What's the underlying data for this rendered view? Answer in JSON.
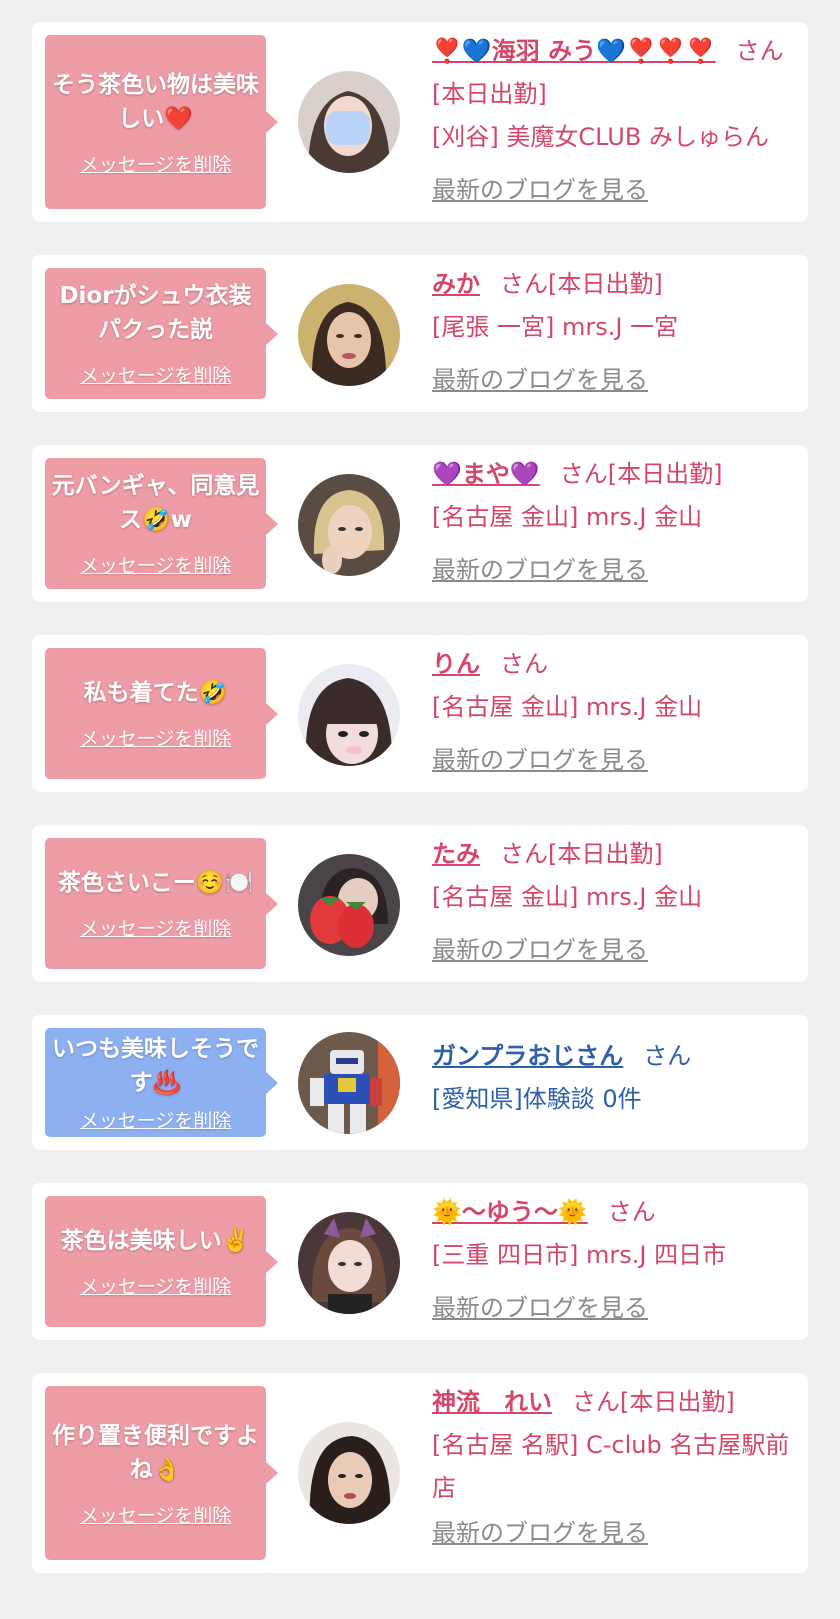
{
  "delete_label": "メッセージを削除",
  "blog_label": "最新のブログを見る",
  "colors": {
    "background": "#f0f0f0",
    "bubble_pink": "#ee9ca6",
    "bubble_blue": "#8db0f0",
    "text_pink": "#d4466a",
    "text_blue": "#2f5fa8"
  },
  "items": [
    {
      "message": "そう茶色い物は美味しい❤️",
      "name": "❣️💙海羽 みう💙❣️❣️❣️",
      "san": "さん",
      "status": "",
      "line2": "[本日出勤]",
      "line3": "[刈谷] 美魔女CLUB みしゅらん",
      "blog": "最新のブログを見る"
    },
    {
      "message": "Diorがシュウ衣装パクった説",
      "name": "みか",
      "san": "さん",
      "status": "[本日出勤]",
      "line2": "[尾張 一宮] mrs.J 一宮",
      "blog": "最新のブログを見る"
    },
    {
      "message": "元バンギャ、同意見ス🤣w",
      "name": "💜まや💜",
      "san": "さん",
      "status": "[本日出勤]",
      "line2": "[名古屋 金山] mrs.J 金山",
      "blog": "最新のブログを見る"
    },
    {
      "message": "私も着てた🤣",
      "name": "りん",
      "san": "さん",
      "status": "",
      "line2": "[名古屋 金山] mrs.J 金山",
      "blog": "最新のブログを見る"
    },
    {
      "message": "茶色さいこー☺️🍽️",
      "name": "たみ",
      "san": "さん",
      "status": "[本日出勤]",
      "line2": "[名古屋 金山] mrs.J 金山",
      "blog": "最新のブログを見る"
    },
    {
      "message": "いつも美味しそうです♨️",
      "name": "ガンプラおじさん",
      "san": "さん",
      "status": "",
      "line2": "[愛知県]体験談 0件",
      "blog": ""
    },
    {
      "message": "茶色は美味しい✌️",
      "name": "🌞〜ゆう〜🌞",
      "san": "さん",
      "status": "",
      "line2": "[三重 四日市] mrs.J 四日市",
      "blog": "最新のブログを見る"
    },
    {
      "message": "作り置き便利ですよね👌",
      "name": "神流　れい",
      "san": "さん",
      "status": "[本日出勤]",
      "line2": "[名古屋 名駅] C-club 名古屋駅前店",
      "blog": "最新のブログを見る"
    }
  ]
}
